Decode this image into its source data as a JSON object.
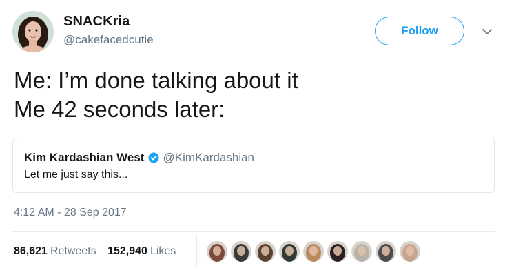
{
  "author": {
    "display_name": "SNACKria",
    "handle": "@cakefacedcutie"
  },
  "follow_button": {
    "label": "Follow"
  },
  "tweet": {
    "text": "Me: I’m done talking about it\nMe 42 seconds later:"
  },
  "quoted_tweet": {
    "display_name": "Kim Kardashian West",
    "handle": "@KimKardashian",
    "text": "Let me just say this..."
  },
  "timestamp": "4:12 AM - 28 Sep 2017",
  "stats": {
    "retweets_count": "86,621",
    "retweets_label": "Retweets",
    "likes_count": "152,940",
    "likes_label": "Likes"
  },
  "icons": {
    "caret": "chevron-down-icon",
    "verified": "verified-badge-icon"
  },
  "colors": {
    "accent": "#1da1f2",
    "secondary_text": "#657786",
    "border": "#e1e8ed"
  },
  "liker_avatars": [
    {
      "tone": "#7a4b3a"
    },
    {
      "tone": "#3a3a3a"
    },
    {
      "tone": "#5a4230"
    },
    {
      "tone": "#2f3a33"
    },
    {
      "tone": "#b88a5e"
    },
    {
      "tone": "#2a1f1f"
    },
    {
      "tone": "#b8b3aa"
    },
    {
      "tone": "#4c4c4c"
    },
    {
      "tone": "#c9a590"
    }
  ]
}
